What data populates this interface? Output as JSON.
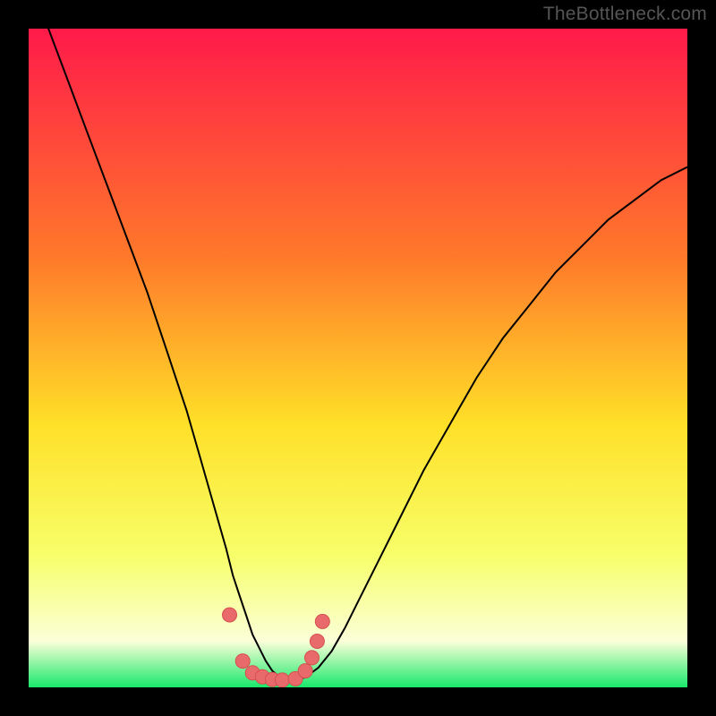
{
  "watermark": "TheBottleneck.com",
  "colors": {
    "gradient_top": "#ff1a4a",
    "gradient_mid_upper": "#ff7a2a",
    "gradient_mid": "#ffe028",
    "gradient_lower": "#f7ff6a",
    "gradient_pale": "#fbffd8",
    "gradient_bottom": "#19e86b",
    "curve": "#000000",
    "marker_fill": "#e86a6a",
    "marker_stroke": "#d64f4f"
  },
  "chart_data": {
    "type": "line",
    "title": "",
    "xlabel": "",
    "ylabel": "",
    "xlim": [
      0,
      100
    ],
    "ylim": [
      0,
      100
    ],
    "curve": {
      "x": [
        0,
        3,
        6,
        9,
        12,
        15,
        18,
        21,
        24,
        26,
        28,
        30,
        31,
        32,
        33,
        34,
        35,
        36,
        37,
        38,
        39,
        40,
        42,
        44,
        46,
        48,
        50,
        53,
        56,
        60,
        64,
        68,
        72,
        76,
        80,
        84,
        88,
        92,
        96,
        100
      ],
      "y": [
        108,
        100,
        92,
        84,
        76,
        68,
        60,
        51,
        42,
        35,
        28,
        21,
        17,
        14,
        11,
        8,
        6,
        4,
        2.5,
        1.7,
        1.3,
        1.1,
        1.5,
        3.0,
        5.5,
        9.0,
        13,
        19,
        25,
        33,
        40,
        47,
        53,
        58,
        63,
        67,
        71,
        74,
        77,
        79
      ]
    },
    "markers": {
      "x": [
        30.5,
        32.5,
        34.0,
        35.5,
        37.0,
        38.5,
        40.5,
        42.0,
        43.0,
        43.8,
        44.6
      ],
      "y": [
        11.0,
        4.0,
        2.2,
        1.6,
        1.2,
        1.1,
        1.3,
        2.5,
        4.5,
        7.0,
        10.0
      ]
    }
  }
}
